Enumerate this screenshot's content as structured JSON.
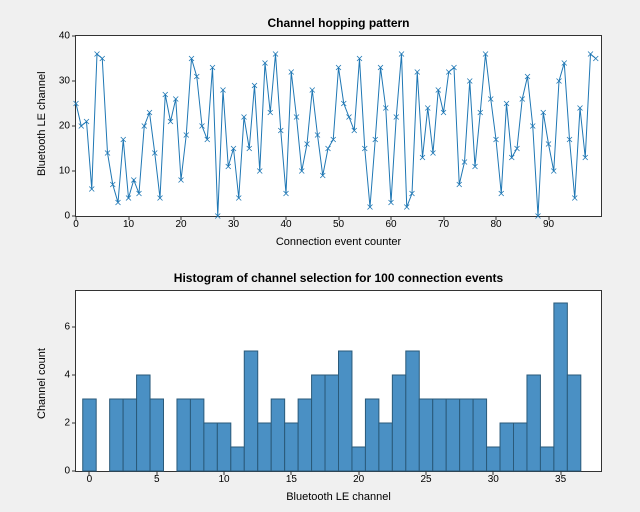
{
  "chart_data": [
    {
      "type": "line",
      "title": "Channel hopping pattern",
      "xlabel": "Connection event counter",
      "ylabel": "Bluetooth LE channel",
      "xlim": [
        0,
        100
      ],
      "ylim": [
        0,
        40
      ],
      "xticks": [
        0,
        10,
        20,
        30,
        40,
        50,
        60,
        70,
        80,
        90
      ],
      "yticks": [
        0,
        10,
        20,
        30,
        40
      ],
      "x": [
        0,
        1,
        2,
        3,
        4,
        5,
        6,
        7,
        8,
        9,
        10,
        11,
        12,
        13,
        14,
        15,
        16,
        17,
        18,
        19,
        20,
        21,
        22,
        23,
        24,
        25,
        26,
        27,
        28,
        29,
        30,
        31,
        32,
        33,
        34,
        35,
        36,
        37,
        38,
        39,
        40,
        41,
        42,
        43,
        44,
        45,
        46,
        47,
        48,
        49,
        50,
        51,
        52,
        53,
        54,
        55,
        56,
        57,
        58,
        59,
        60,
        61,
        62,
        63,
        64,
        65,
        66,
        67,
        68,
        69,
        70,
        71,
        72,
        73,
        74,
        75,
        76,
        77,
        78,
        79,
        80,
        81,
        82,
        83,
        84,
        85,
        86,
        87,
        88,
        89,
        90,
        91,
        92,
        93,
        94,
        95,
        96,
        97,
        98,
        99
      ],
      "y": [
        25,
        20,
        21,
        6,
        36,
        35,
        14,
        7,
        3,
        17,
        4,
        8,
        5,
        20,
        23,
        14,
        4,
        27,
        21,
        26,
        8,
        18,
        35,
        31,
        20,
        17,
        33,
        0,
        28,
        11,
        15,
        4,
        22,
        15,
        29,
        10,
        34,
        23,
        36,
        19,
        5,
        32,
        22,
        10,
        16,
        28,
        18,
        9,
        15,
        17,
        33,
        25,
        22,
        19,
        35,
        15,
        2,
        17,
        33,
        24,
        3,
        22,
        36,
        2,
        5,
        32,
        13,
        24,
        14,
        28,
        23,
        32,
        33,
        7,
        12,
        30,
        11,
        23,
        36,
        26,
        17,
        5,
        25,
        13,
        15,
        26,
        31,
        20,
        0,
        23,
        16,
        10,
        30,
        34,
        17,
        4,
        24,
        13,
        36,
        35
      ],
      "marker": "x"
    },
    {
      "type": "bar",
      "title": "Histogram of channel selection for 100 connection events",
      "xlabel": "Bluetooth LE channel",
      "ylabel": "Channel count",
      "xlim": [
        -1,
        38
      ],
      "ylim": [
        0,
        7.5
      ],
      "xticks": [
        0,
        5,
        10,
        15,
        20,
        25,
        30,
        35
      ],
      "yticks": [
        0,
        2,
        4,
        6
      ],
      "categories": [
        0,
        1,
        2,
        3,
        4,
        5,
        6,
        7,
        8,
        9,
        10,
        11,
        12,
        13,
        14,
        15,
        16,
        17,
        18,
        19,
        20,
        21,
        22,
        23,
        24,
        25,
        26,
        27,
        28,
        29,
        30,
        31,
        32,
        33,
        34,
        35,
        36
      ],
      "values": [
        3,
        0,
        3,
        3,
        4,
        3,
        0,
        3,
        3,
        2,
        2,
        1,
        5,
        2,
        3,
        2,
        3,
        4,
        4,
        5,
        1,
        3,
        2,
        4,
        5,
        3,
        3,
        3,
        3,
        3,
        1,
        2,
        2,
        4,
        1,
        7,
        4
      ]
    }
  ]
}
